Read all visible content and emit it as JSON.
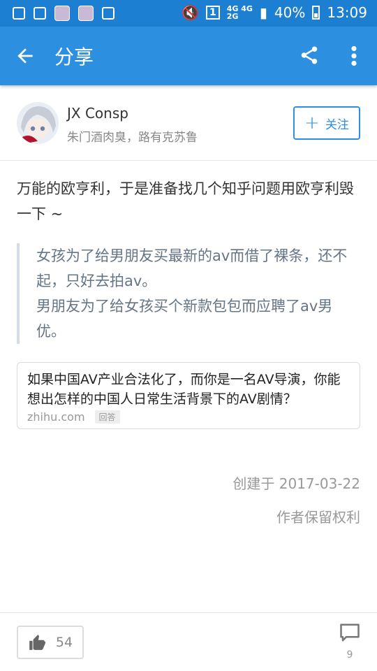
{
  "status_bar": {
    "network_top": "4G 4G",
    "network_bottom": "2G",
    "sim_slot": "1",
    "battery": "40%",
    "time": "13:09"
  },
  "app_bar": {
    "title": "分享",
    "back_icon": "arrow-left-icon",
    "share_icon": "share-icon",
    "more_icon": "more-vertical-icon"
  },
  "author": {
    "name": "JX Consp",
    "bio": "朱门酒肉臭，路有克苏鲁",
    "follow_label": "关注"
  },
  "post": {
    "body": "万能的欧亨利，于是准备找几个知乎问题用欧亨利毁一下 ~",
    "quote_lines": [
      "女孩为了给男朋友买最新的av而借了裸条，还不起，只好去拍av。",
      "男朋友为了给女孩买个新款包包而应聘了av男优。"
    ]
  },
  "link_card": {
    "title": "如果中国AV产业合法化了，而你是一名AV导演，你能想出怎样的中国人日常生活背景下的AV剧情？",
    "domain": "zhihu.com",
    "tag": "回答"
  },
  "footer_meta": {
    "created": "创建于 2017-03-22",
    "rights": "作者保留权利"
  },
  "bottom_bar": {
    "like_count": "54",
    "comment_count": "9"
  },
  "colors": {
    "status_bar": "#1d7fd1",
    "app_bar": "#2d8fe0",
    "accent": "#2d8fe0",
    "quote_text": "#657585"
  }
}
